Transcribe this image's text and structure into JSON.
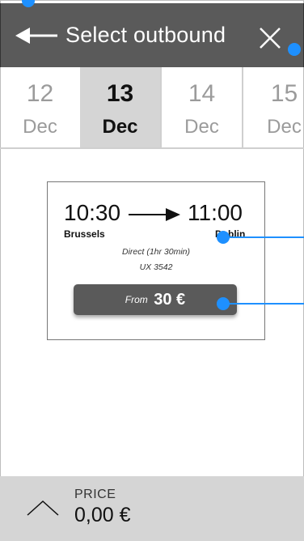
{
  "header": {
    "title": "Select outbound",
    "back_icon": "arrow-left-icon",
    "close_icon": "close-icon"
  },
  "dates": [
    {
      "day": "12",
      "month": "Dec",
      "selected": false
    },
    {
      "day": "13",
      "month": "Dec",
      "selected": true
    },
    {
      "day": "14",
      "month": "Dec",
      "selected": false
    },
    {
      "day": "15",
      "month": "Dec",
      "selected": false
    }
  ],
  "flight": {
    "departure_time": "10:30",
    "arrival_time": "11:00",
    "departure_city": "Brussels",
    "arrival_city": "Dublin",
    "duration": "Direct (1hr 30min)",
    "flight_number": "UX 3542",
    "price_prefix": "From",
    "price": "30 €"
  },
  "footer": {
    "label": "PRICE",
    "total": "0,00 €",
    "chevron_icon": "chevron-up-icon"
  },
  "colors": {
    "header_bg": "#5a5a5a",
    "selected_date_bg": "#d5d5d5",
    "footer_bg": "#d5d5d5",
    "annotation": "#1e90ff"
  }
}
